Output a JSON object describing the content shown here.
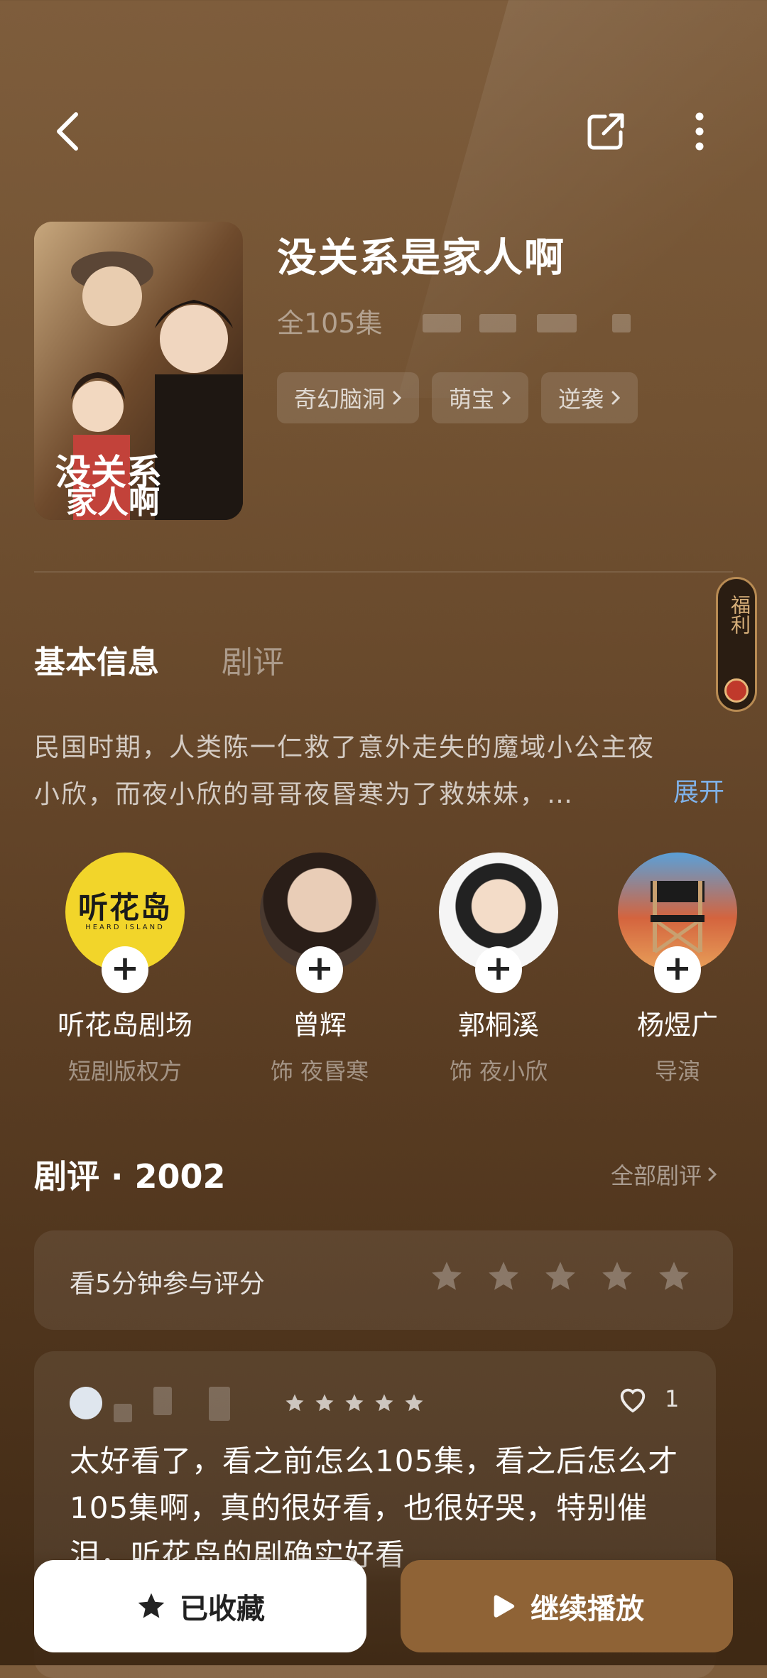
{
  "header": {
    "back_icon": "chevron-left-icon",
    "share_icon": "share-icon",
    "more_icon": "more-vertical-icon"
  },
  "drama": {
    "title": "没关系是家人啊",
    "episodes": "全105集",
    "tags": [
      {
        "label": "奇幻脑洞"
      },
      {
        "label": "萌宝"
      },
      {
        "label": "逆袭"
      }
    ]
  },
  "tabs": {
    "active": "基本信息",
    "inactive": "剧评"
  },
  "welfare": {
    "label": "福利"
  },
  "synopsis": {
    "text": "民国时期，人类陈一仁救了意外走失的魔域小公主夜小欣，而夜小欣的哥哥夜昬寒为了救妹妹，…",
    "expand": "展开"
  },
  "cast": [
    {
      "name": "听花岛剧场",
      "role": "短剧版权方",
      "logo_text": "听花岛",
      "logo_sub": "HEARD ISLAND"
    },
    {
      "name": "曾辉",
      "role": "饰 夜昬寒"
    },
    {
      "name": "郭桐溪",
      "role": "饰 夜小欣"
    },
    {
      "name": "杨煜广",
      "role": "导演"
    }
  ],
  "reviews": {
    "heading": "剧评 · 2002",
    "all_link": "全部剧评",
    "rate_prompt": "看5分钟参与评分",
    "first_review": {
      "likes": "1",
      "text": "太好看了，看之前怎么105集，看之后怎么才105集啊，真的很好看，也很好哭，特别催泪，听花岛的剧确实好看"
    }
  },
  "actions": {
    "favorited": "已收藏",
    "continue": "继续播放"
  },
  "colors": {
    "accent_blue": "#7fb1e8",
    "play_button": "#8f6336",
    "logo_yellow": "#f2d52a"
  }
}
